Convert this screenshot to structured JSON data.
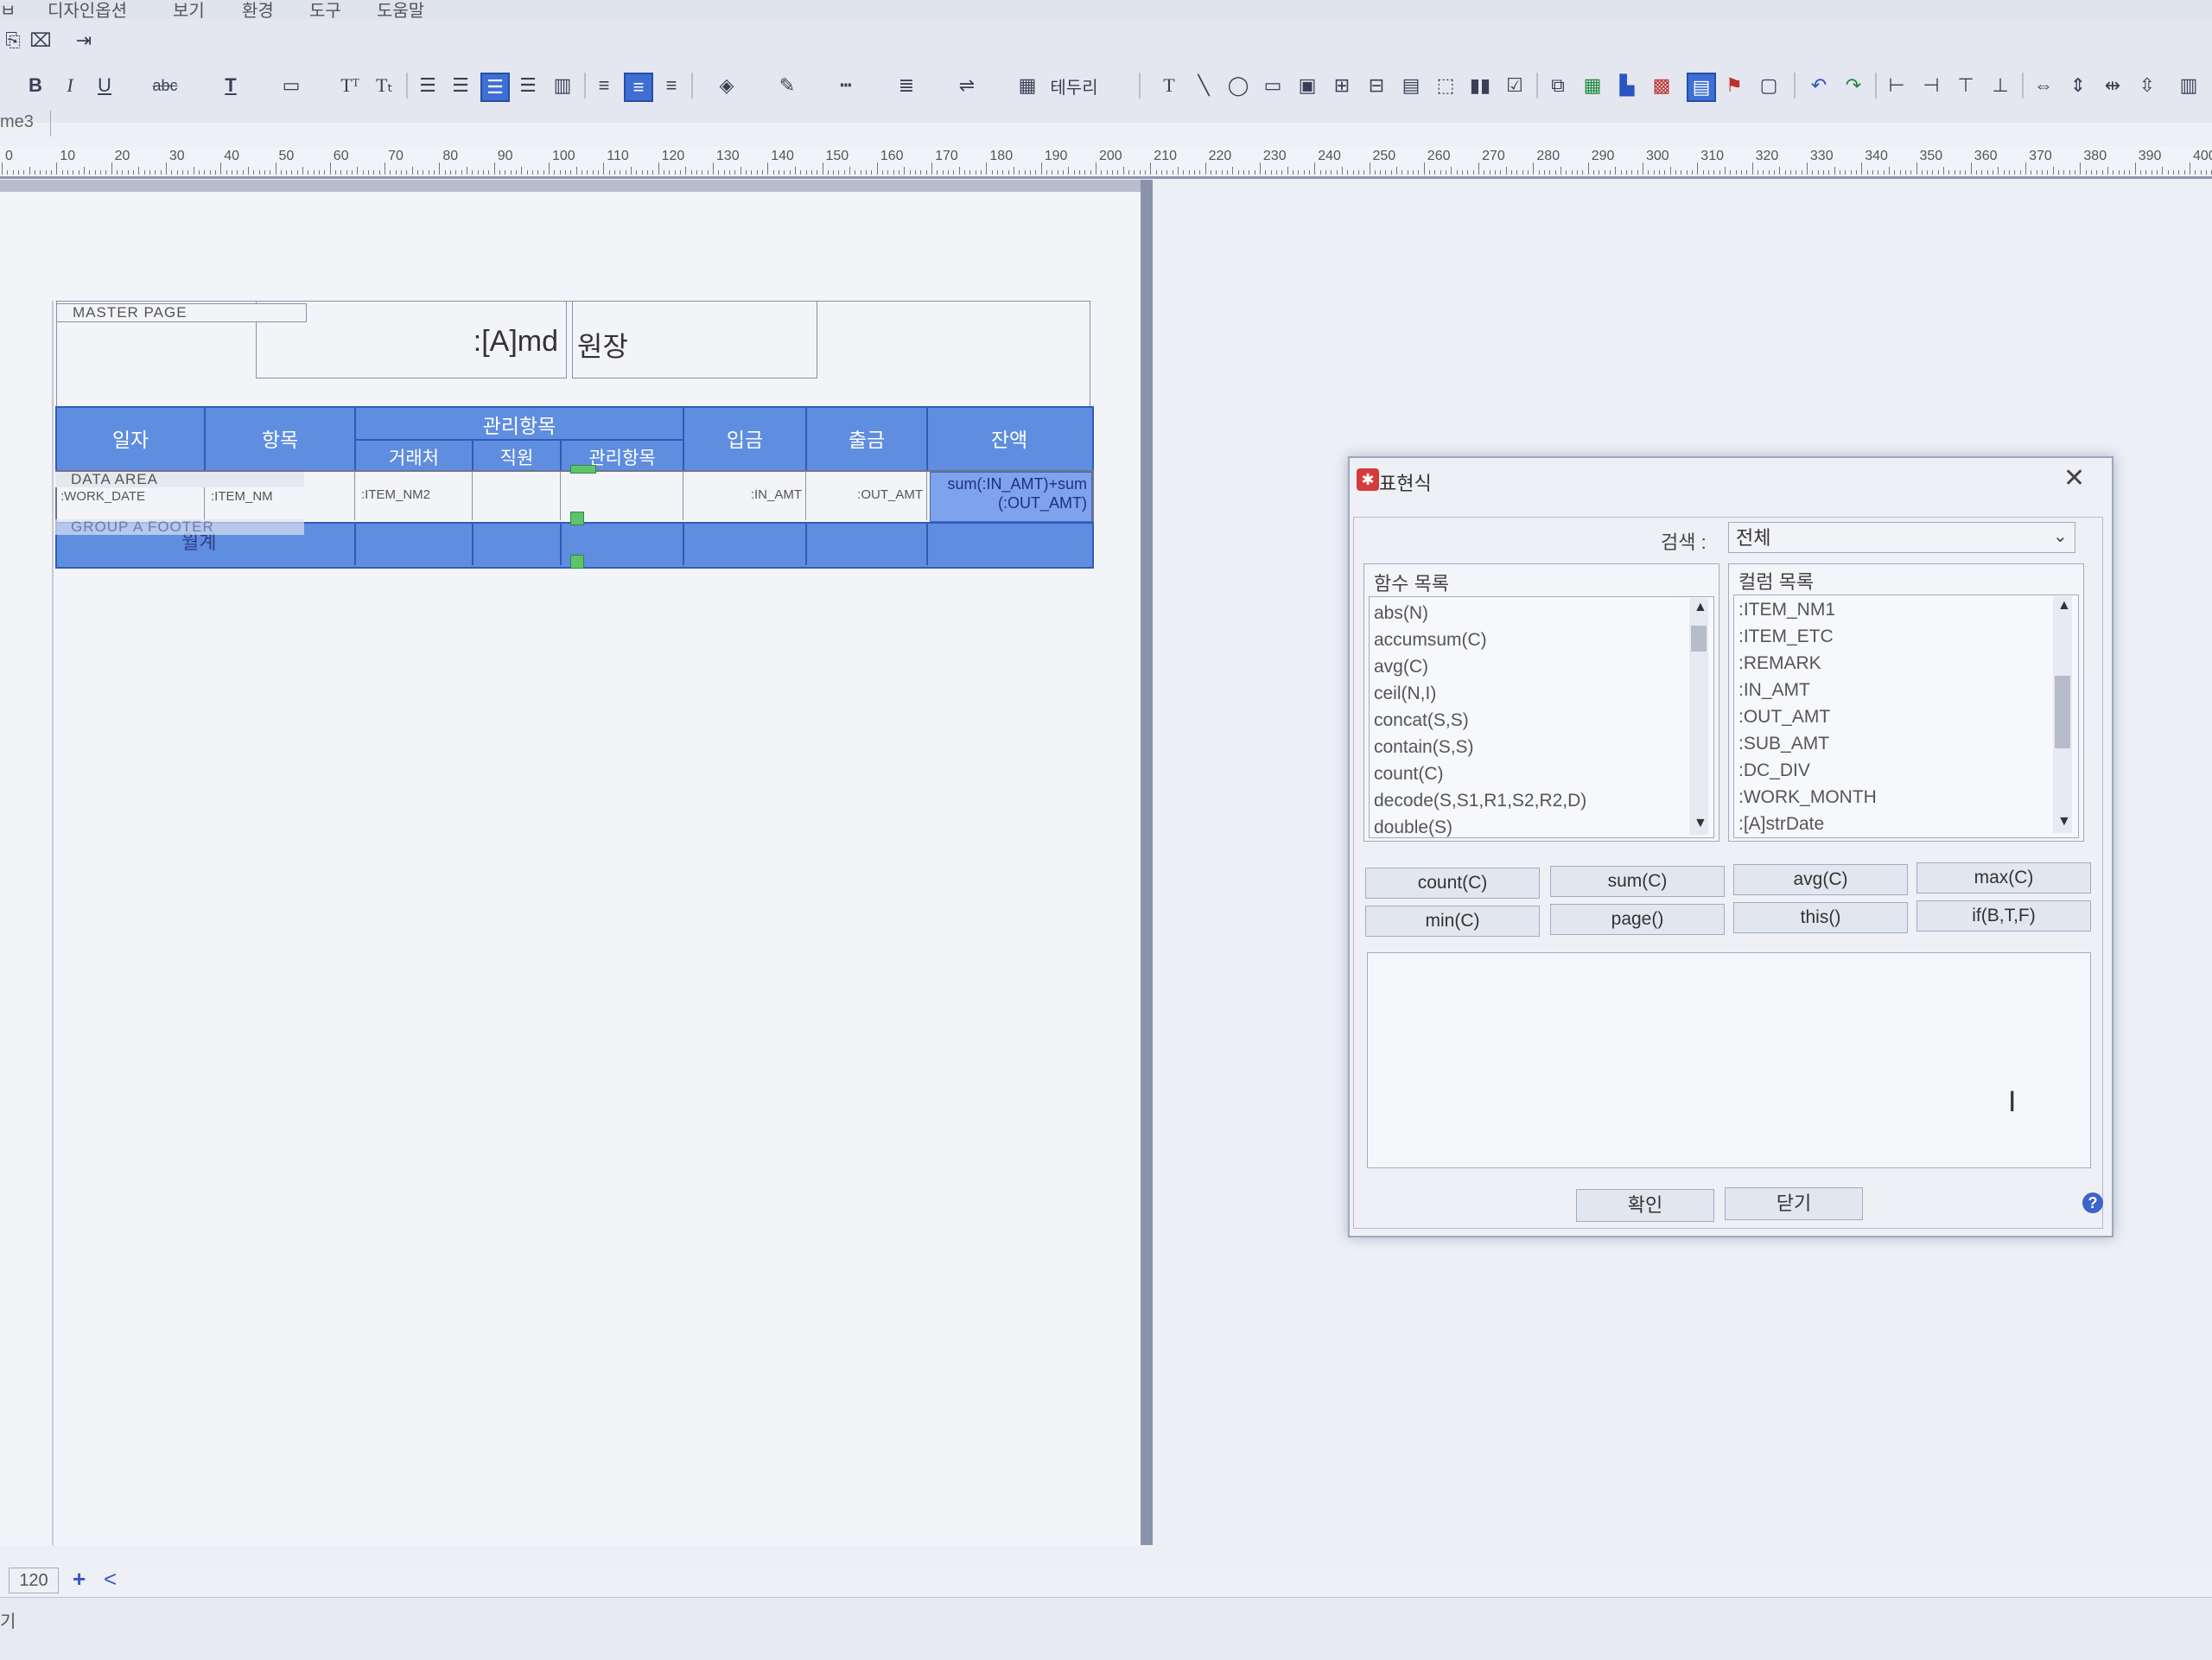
{
  "menu": [
    "ㅂ",
    "디자인옵션",
    "보기",
    "환경",
    "도구",
    "도움말"
  ],
  "toolbar": {
    "bold": "B",
    "italic": "I",
    "underline": "U",
    "strike": "abc",
    "border_label": "테두리"
  },
  "doc_tab": "me3",
  "ruler": [
    "0",
    "10",
    "20",
    "30",
    "40",
    "50",
    "60",
    "70",
    "80",
    "90",
    "100",
    "110",
    "120",
    "130",
    "140",
    "150",
    "160",
    "170",
    "180",
    "190",
    "200",
    "210",
    "220",
    "230",
    "240",
    "250",
    "260",
    "270",
    "280",
    "290",
    "300",
    "310",
    "320",
    "330",
    "340",
    "350",
    "360",
    "370",
    "380",
    "390",
    "400"
  ],
  "report": {
    "master_label": "MASTER PAGE",
    "title_expr": ":[A]md",
    "title_text": "원장",
    "headers": {
      "date": "일자",
      "item": "항목",
      "mgmt_group": "관리항목",
      "partner": "거래처",
      "staff": "직원",
      "mgmt_item": "관리항목",
      "income": "입금",
      "outgo": "출금",
      "balance": "잔액"
    },
    "data_label": "DATA AREA",
    "data": {
      "work_date": ":WORK_DATE",
      "item_nm": ":ITEM_NM",
      "item_nm2": ":ITEM_NM2",
      "in_amt": ":IN_AMT",
      "out_amt": ":OUT_AMT",
      "sum_line1": "sum(:IN_AMT)+sum",
      "sum_line2": "(:OUT_AMT)"
    },
    "group_label": "GROUP A FOOTER",
    "footer_text": "월계"
  },
  "status": {
    "zoom": "120",
    "plus": "+",
    "back": "<",
    "text": "기"
  },
  "dialog": {
    "title": "표현식",
    "close": "✕",
    "search_label": "검색 :",
    "search_value": "전체",
    "func_header": "함수 목록",
    "col_header": "컬럼 목록",
    "functions": [
      "abs(N)",
      "accumsum(C)",
      "avg(C)",
      "ceil(N,I)",
      "concat(S,S)",
      "contain(S,S)",
      "count(C)",
      "decode(S,S1,R1,S2,R2,D)",
      "double(S)"
    ],
    "columns": [
      ":ITEM_NM1",
      ":ITEM_ETC",
      ":REMARK",
      ":IN_AMT",
      ":OUT_AMT",
      ":SUB_AMT",
      ":DC_DIV",
      ":WORK_MONTH",
      ":[A]strDate"
    ],
    "quick_buttons": [
      "count(C)",
      "sum(C)",
      "avg(C)",
      "max(C)",
      "min(C)",
      "page()",
      "this()",
      "if(B,T,F)"
    ],
    "expression_value": "",
    "ok": "확인",
    "cancel": "닫기",
    "help": "?"
  }
}
